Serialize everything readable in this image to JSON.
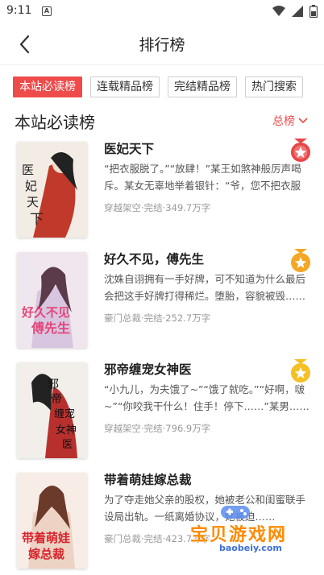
{
  "status": {
    "time": "9:11",
    "notification_letter": "A"
  },
  "header": {
    "title": "排行榜"
  },
  "tabs": [
    {
      "label": "本站必读榜",
      "active": true
    },
    {
      "label": "连载精品榜",
      "active": false
    },
    {
      "label": "完结精品榜",
      "active": false
    },
    {
      "label": "热门搜索",
      "active": false
    }
  ],
  "section": {
    "title": "本站必读榜",
    "sort_label": "总榜"
  },
  "books": [
    {
      "title": "医妃天下",
      "desc": "“把衣服脱了。”“放肆！”某王如煞神般厉声喝斥。某女无辜地举着银针：“爷，您不把衣服脱了，我怎么帮您施针？”",
      "meta": "穿越架空·完结·349.7万字",
      "cover_text": "医妃天下",
      "rank_color": "#e84545"
    },
    {
      "title": "好久不见，傅先生",
      "desc": "沈姝自诩拥有一手好牌，可不知道为什么最后会把这手好牌打得稀烂。堕胎，容貌被毁……",
      "meta": "豪门总裁·完结·252.7万字",
      "cover_text": "好久不见傅先生",
      "rank_color": "#f5a623"
    },
    {
      "title": "邪帝缠宠女神医",
      "desc": "“小九儿，为夫饿了~”“饿了就吃。”“好啊，啵~”“你咬我干什么！住手！停下……”某男……",
      "meta": "穿越架空·完结·796.9万字",
      "cover_text": "邪帝缠宠女神医",
      "rank_color": "#f5c023"
    },
    {
      "title": "带着萌娃嫁总裁",
      "desc": "为了夺走她父亲的股权，她被老公和闺蜜联手设局出轨。一纸离婚协议，她被迫……",
      "meta": "豪门总裁·完结·423.7万字",
      "cover_text": "带着萌娃嫁总裁",
      "rank_color": ""
    }
  ],
  "watermark": {
    "brand": "宝贝游戏网",
    "url": "baobeiy.com"
  }
}
